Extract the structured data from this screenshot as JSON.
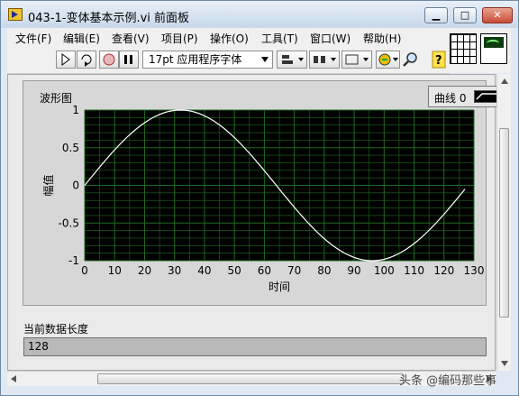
{
  "window": {
    "title": "043-1-变体基本示例.vi 前面板"
  },
  "menu": [
    "文件(F)",
    "编辑(E)",
    "查看(V)",
    "项目(P)",
    "操作(O)",
    "工具(T)",
    "窗口(W)",
    "帮助(H)"
  ],
  "toolbar": {
    "font": "17pt 应用程序字体"
  },
  "graph": {
    "label": "波形图",
    "legend_label": "曲线 0"
  },
  "chart_data": {
    "type": "line",
    "xlabel": "时间",
    "ylabel": "幅值",
    "xlim": [
      0,
      130
    ],
    "ylim": [
      -1,
      1
    ],
    "xticks": [
      0,
      10,
      20,
      30,
      40,
      50,
      60,
      70,
      80,
      90,
      100,
      110,
      120,
      130
    ],
    "yticks": [
      1,
      0.5,
      0,
      -0.5,
      -1
    ],
    "ytick_labels": [
      "1",
      "0.5",
      "0",
      "-0.5",
      "-1"
    ],
    "grid": true,
    "series": [
      {
        "function": "sin(2*pi*x/128)",
        "x_start": 0,
        "x_end": 127,
        "points": 128,
        "color": "#ffffff"
      }
    ]
  },
  "data_length": {
    "label": "当前数据长度",
    "value": "128"
  },
  "watermark": "头条 @编码那些事",
  "colors": {
    "plot_bg": "#000000",
    "grid": "#1f6b1f",
    "trace": "#ffffff",
    "frame": "#d7d7d7"
  }
}
